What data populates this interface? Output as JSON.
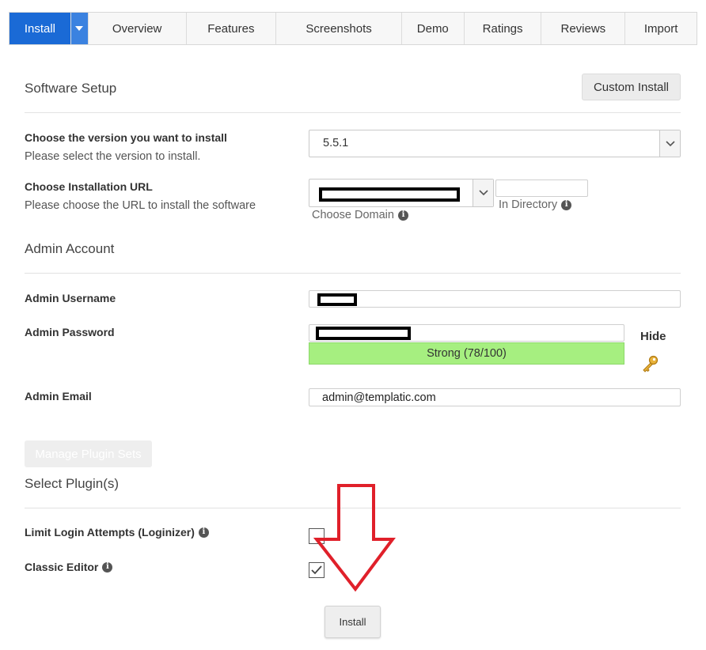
{
  "tabs": {
    "install": "Install",
    "overview": "Overview",
    "features": "Features",
    "screenshots": "Screenshots",
    "demo": "Demo",
    "ratings": "Ratings",
    "reviews": "Reviews",
    "import": "Import"
  },
  "setup": {
    "title": "Software Setup",
    "custom_install": "Custom Install",
    "version_label": "Choose the version you want to install",
    "version_help": "Please select the version to install.",
    "version_value": "5.5.1",
    "url_label": "Choose Installation URL",
    "url_help": "Please choose the URL to install the software",
    "choose_domain": "Choose Domain",
    "in_directory": "In Directory"
  },
  "admin": {
    "title": "Admin Account",
    "username_label": "Admin Username",
    "password_label": "Admin Password",
    "strength": "Strong (78/100)",
    "strength_score": 78,
    "hide": "Hide",
    "email_label": "Admin Email",
    "email_value": "admin@templatic.com"
  },
  "plugins": {
    "manage": "Manage Plugin Sets",
    "title": "Select Plugin(s)",
    "items": [
      {
        "label": "Limit Login Attempts (Loginizer)",
        "checked": false
      },
      {
        "label": "Classic Editor",
        "checked": true
      }
    ]
  },
  "install_button": "Install",
  "colors": {
    "tab_active": "#1a6ad6",
    "strength_bar": "#a6ef80",
    "annotation_arrow": "#e0202a"
  },
  "icons": {
    "caret": "caret-down-icon",
    "chevron": "chevron-down-icon",
    "info": "info-icon",
    "key": "key-icon",
    "check": "checkmark-icon",
    "annotation": "red-down-arrow-icon"
  }
}
